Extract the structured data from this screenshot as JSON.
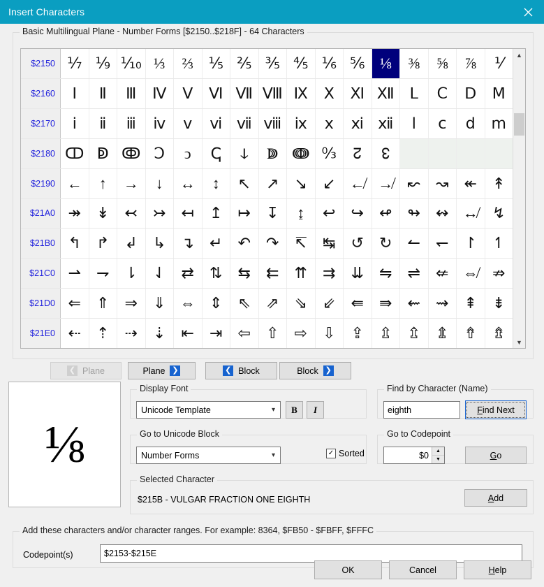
{
  "window": {
    "title": "Insert Characters",
    "close_icon": "close-icon",
    "titlebar_color": "#0a9ec1"
  },
  "grid_group": {
    "label": "Basic Multilingual Plane - Number Forms [$2150..$218F] - 64 Characters",
    "columns": 16,
    "selected_index": {
      "row": 0,
      "col": 11
    },
    "selection_color": "#00007c",
    "row_label_color": "#2222dd",
    "rows": [
      {
        "label": "$2150",
        "cells": [
          "⅐",
          "⅑",
          "⅒",
          "⅓",
          "⅔",
          "⅕",
          "⅖",
          "⅗",
          "⅘",
          "⅙",
          "⅚",
          "⅛",
          "⅜",
          "⅝",
          "⅞",
          "⅟"
        ]
      },
      {
        "label": "$2160",
        "cells": [
          "Ⅰ",
          "Ⅱ",
          "Ⅲ",
          "Ⅳ",
          "Ⅴ",
          "Ⅵ",
          "Ⅶ",
          "Ⅷ",
          "Ⅸ",
          "Ⅹ",
          "Ⅺ",
          "Ⅻ",
          "Ⅼ",
          "Ⅽ",
          "Ⅾ",
          "Ⅿ"
        ]
      },
      {
        "label": "$2170",
        "cells": [
          "ⅰ",
          "ⅱ",
          "ⅲ",
          "ⅳ",
          "ⅴ",
          "ⅵ",
          "ⅶ",
          "ⅷ",
          "ⅸ",
          "ⅹ",
          "ⅺ",
          "ⅻ",
          "ⅼ",
          "ⅽ",
          "ⅾ",
          "ⅿ"
        ]
      },
      {
        "label": "$2180",
        "cells": [
          "ↀ",
          "ↁ",
          "ↂ",
          "Ↄ",
          "ↄ",
          "ↅ",
          "ↆ",
          "ↇ",
          "ↈ",
          "↉",
          "↊",
          "↋",
          "",
          "",
          "",
          ""
        ]
      },
      {
        "label": "$2190",
        "cells": [
          "←",
          "↑",
          "→",
          "↓",
          "↔",
          "↕",
          "↖",
          "↗",
          "↘",
          "↙",
          "↚",
          "↛",
          "↜",
          "↝",
          "↞",
          "↟"
        ]
      },
      {
        "label": "$21A0",
        "cells": [
          "↠",
          "↡",
          "↢",
          "↣",
          "↤",
          "↥",
          "↦",
          "↧",
          "↨",
          "↩",
          "↪",
          "↫",
          "↬",
          "↭",
          "↮",
          "↯"
        ]
      },
      {
        "label": "$21B0",
        "cells": [
          "↰",
          "↱",
          "↲",
          "↳",
          "↴",
          "↵",
          "↶",
          "↷",
          "↸",
          "↹",
          "↺",
          "↻",
          "↼",
          "↽",
          "↾",
          "↿"
        ]
      },
      {
        "label": "$21C0",
        "cells": [
          "⇀",
          "⇁",
          "⇂",
          "⇃",
          "⇄",
          "⇅",
          "⇆",
          "⇇",
          "⇈",
          "⇉",
          "⇊",
          "⇋",
          "⇌",
          "⇍",
          "⇎",
          "⇏"
        ]
      },
      {
        "label": "$21D0",
        "cells": [
          "⇐",
          "⇑",
          "⇒",
          "⇓",
          "⇔",
          "⇕",
          "⇖",
          "⇗",
          "⇘",
          "⇙",
          "⇚",
          "⇛",
          "⇜",
          "⇝",
          "⇞",
          "⇟"
        ]
      },
      {
        "label": "$21E0",
        "cells": [
          "⇠",
          "⇡",
          "⇢",
          "⇣",
          "⇤",
          "⇥",
          "⇦",
          "⇧",
          "⇨",
          "⇩",
          "⇪",
          "⇫",
          "⇬",
          "⇭",
          "⇮",
          "⇯"
        ]
      }
    ],
    "scrollbar": {
      "up_icon": "chevron-up-icon",
      "down_icon": "chevron-down-icon"
    }
  },
  "nav": {
    "plane_prev": {
      "label": "Plane",
      "icon": "arrow-left-icon",
      "disabled": true
    },
    "plane_next": {
      "label": "Plane",
      "icon": "arrow-right-icon",
      "disabled": false
    },
    "block_prev": {
      "label": "Block",
      "icon": "arrow-left-icon",
      "disabled": false
    },
    "block_next": {
      "label": "Block",
      "icon": "arrow-right-icon",
      "disabled": false
    }
  },
  "preview": {
    "glyph": "⅛"
  },
  "display_font": {
    "label": "Display Font",
    "value": "Unicode Template",
    "bold_label": "B",
    "italic_label": "I",
    "chevron_icon": "chevron-down-icon"
  },
  "go_block": {
    "label": "Go to Unicode Block",
    "value": "Number Forms",
    "sorted_label": "Sorted",
    "sorted_checked": true,
    "chevron_icon": "chevron-down-icon"
  },
  "find": {
    "label": "Find by Character (Name)",
    "value": "eighth",
    "button_label": "Find Next",
    "button_accel": "F",
    "focused": true
  },
  "codepoint": {
    "label": "Go to Codepoint",
    "value": "$0",
    "button_label": "Go",
    "button_accel": "G",
    "up_icon": "spinner-up-icon",
    "down_icon": "spinner-down-icon"
  },
  "selected_character": {
    "label": "Selected Character",
    "text": "$215B - VULGAR FRACTION ONE EIGHTH",
    "add_label": "Add",
    "add_accel": "A"
  },
  "add_ranges": {
    "label": "Add these characters and/or character ranges. For example: 8364, $FB50 - $FBFF, $FFFC",
    "field_label": "Codepoint(s)",
    "value": "$2153-$215E"
  },
  "footer": {
    "ok": "OK",
    "cancel": "Cancel",
    "help": "Help",
    "help_accel": "H"
  }
}
